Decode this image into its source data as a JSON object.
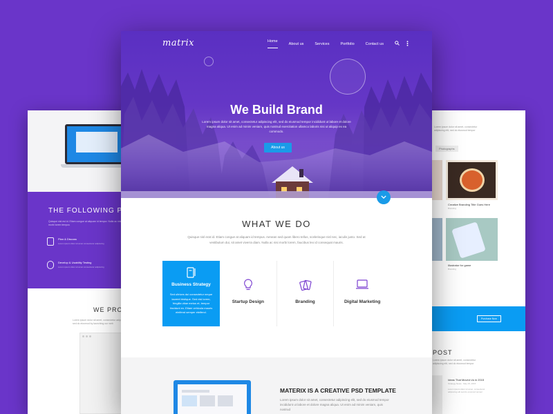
{
  "left_page": {
    "heading": "THE  FOLLOWING PREC",
    "intro": "Quisque nisl est id. Etiam congue at aliquam id tempor. Nulla ac nisi morbi lorem tempus",
    "features": [
      {
        "title": "Plan & Discuss",
        "desc": "Lorem ipsum dolor sit amet consectetur adipiscing"
      },
      {
        "title": "Develop & Usability Testing",
        "desc": "Lorem ipsum dolor sit amet consectetur adipiscing"
      }
    ],
    "section_heading": "WE PROV",
    "section_text": "Lorem ipsum dolor sit amet, consectetur adipiscing elit, sed do eiusmod by launching our web"
  },
  "right_page": {
    "intro": "Lorem ipsum dolor sit amet, consectetur adipiscing elit, sed do eiusmod tempor",
    "tab": "Photographs",
    "items": [
      {
        "title": "Creative Branding Title Goes Here",
        "category": "Branding"
      },
      {
        "title": "Illustrator for game",
        "category": "Branding"
      }
    ],
    "cta": "Purchase Now",
    "post_heading": "POST",
    "post_intro": "Lorem ipsum dolor sit amet, consectetur adipiscing elit, sed do eiusmod tempor",
    "post_title": "Ideas That Moved Us in 2015",
    "post_meta": "Strategy News  ·  May 15, 2015",
    "post_text": "Lorem ipsum dolor sit amet, consectetur adipiscing elit sed do eiusmod tempor"
  },
  "header": {
    "logo": "matrix",
    "nav": [
      "Home",
      "About us",
      "Services",
      "Portfolio",
      "Contact us"
    ],
    "active_nav": "Home"
  },
  "hero": {
    "title": "We Build Brand",
    "lead": "Lorem ipsum dolor sit amet, consectetur adipiscing elit, sed do eiusmod tempor incididunt ut labore et dolore magna aliqua. Ut enim ad minim veniam, quis nostrud exercitation ullamco laboris nisi ut aliquip ex ea commodo.",
    "cta": "About us"
  },
  "what_we_do": {
    "heading": "WHAT WE DO",
    "text": "Quisque nisl erat id. Etiam congue at aliquam id tempus. Aenean sed quam libero tellus, scelerisque nisl nec, iaculis justo. Sed at vestibulum dui, sit amet viverra diam. Nulla ac nisi morbi lorem, faucibus leo id consequat mauris."
  },
  "services": [
    {
      "title": "Business Strategy",
      "desc": "Sed ultrices dui consectetur neque laoreet tristique. Sed nisl lorem, fringilla vitae metus et, tempor tincidunt ex. Etiam vehicula mauris eleifend semper eleifend.",
      "icon": "notebook-icon"
    },
    {
      "title": "Startup Design",
      "icon": "lightbulb-icon"
    },
    {
      "title": "Branding",
      "icon": "cards-icon"
    },
    {
      "title": "Digital Marketing",
      "icon": "laptop-icon"
    }
  ],
  "promo": {
    "heading": "MATERIX IS A CREATIVE PSD TEMPLATE",
    "text": "Lorem ipsum dolor sit amet, consectetur adipiscing elit, sed do eiusmod tempor incididunt ut labore et dolore magna aliqua. Ut enim ad minim veniam, quis nostrud"
  },
  "colors": {
    "background": "#6a35c9",
    "accent": "#0a9cf3",
    "hero": "#5a2fc2"
  }
}
